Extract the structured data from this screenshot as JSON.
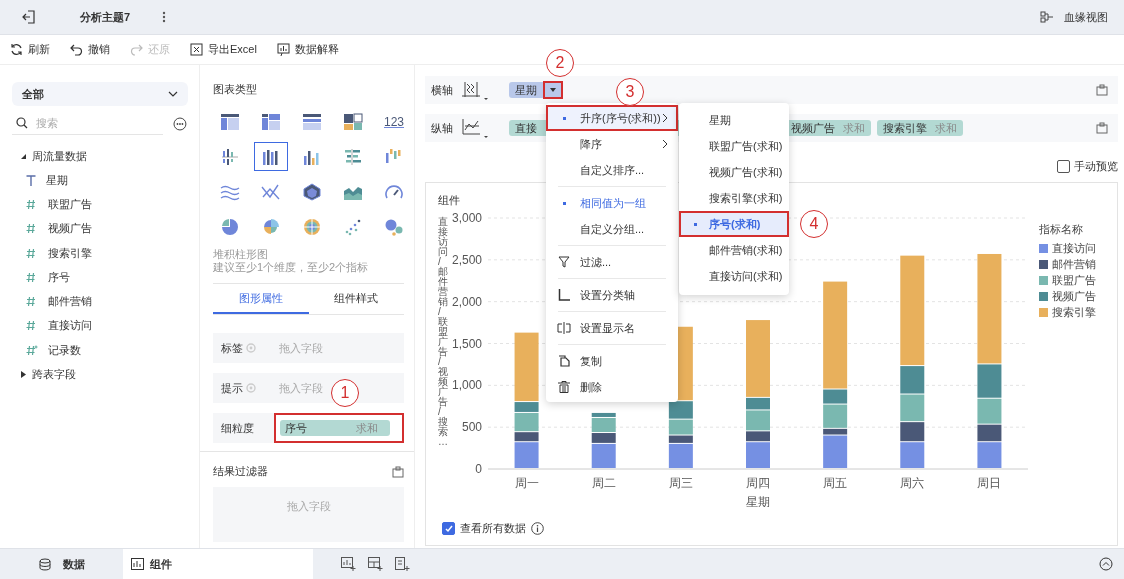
{
  "topbar": {
    "title": "分析主题7",
    "lineage": "血缘视图"
  },
  "toolbar": [
    {
      "label": "刷新",
      "kind": "refresh",
      "disabled": false
    },
    {
      "label": "撤销",
      "kind": "undo",
      "disabled": false
    },
    {
      "label": "还原",
      "kind": "redo",
      "disabled": true
    },
    {
      "label": "导出Excel",
      "kind": "excel",
      "disabled": false
    },
    {
      "label": "数据解释",
      "kind": "explain",
      "disabled": false
    }
  ],
  "fields_panel": {
    "scope": "全部",
    "search_placeholder": "搜索",
    "tree": [
      {
        "label": "周流量数据",
        "expanded": true,
        "children": [
          {
            "label": "星期",
            "kind": "text"
          },
          {
            "label": "联盟广告",
            "kind": "number"
          },
          {
            "label": "视频广告",
            "kind": "number"
          },
          {
            "label": "搜索引擎",
            "kind": "number"
          },
          {
            "label": "序号",
            "kind": "number"
          },
          {
            "label": "邮件营销",
            "kind": "number"
          },
          {
            "label": "直接访问",
            "kind": "number"
          },
          {
            "label": "记录数",
            "kind": "count"
          }
        ]
      },
      {
        "label": "跨表字段",
        "expanded": false
      }
    ]
  },
  "chart_types": {
    "title": "图表类型",
    "items": [
      {
        "kind": "table",
        "selected": false
      },
      {
        "kind": "crosstab",
        "selected": false
      },
      {
        "kind": "grouptable",
        "selected": false
      },
      {
        "kind": "treemap",
        "selected": false
      },
      {
        "kind": "number",
        "label": "123",
        "selected": false
      },
      {
        "kind": "groupbar",
        "selected": false
      },
      {
        "kind": "stackcol",
        "selected": true
      },
      {
        "kind": "column",
        "selected": false
      },
      {
        "kind": "hbar",
        "selected": false
      },
      {
        "kind": "rangecol",
        "selected": false
      },
      {
        "kind": "multiline",
        "selected": false
      },
      {
        "kind": "crossline",
        "selected": false
      },
      {
        "kind": "radar",
        "selected": false
      },
      {
        "kind": "area",
        "selected": false
      },
      {
        "kind": "gauge",
        "selected": false
      },
      {
        "kind": "pie",
        "selected": false
      },
      {
        "kind": "rosepie",
        "selected": false
      },
      {
        "kind": "sunburst",
        "selected": false
      },
      {
        "kind": "scatter",
        "selected": false
      },
      {
        "kind": "bubble",
        "selected": false
      }
    ],
    "name": "堆积柱形图",
    "hint": "建议至少1个维度，至少2个指标"
  },
  "property_tabs": [
    {
      "label": "图形属性",
      "selected": true
    },
    {
      "label": "组件样式",
      "selected": false
    }
  ],
  "properties": [
    {
      "label": "标签",
      "placeholder": "拖入字段",
      "highlighted": false
    },
    {
      "label": "提示",
      "placeholder": "拖入字段",
      "highlighted": false
    },
    {
      "label": "细粒度",
      "pill": {
        "name": "序号",
        "agg": "求和"
      },
      "highlighted": true
    }
  ],
  "result_filter": {
    "title": "结果过滤器",
    "placeholder": "拖入字段"
  },
  "axes": [
    {
      "label": "横轴",
      "kind": "x",
      "pills": [
        {
          "name": "星期",
          "kind": "dimension",
          "dropdown": true,
          "highlighted": true
        }
      ]
    },
    {
      "label": "纵轴",
      "kind": "y",
      "pills": [
        {
          "name": "直接",
          "kind": "measure"
        },
        {
          "name": "视频广告",
          "agg": "求和",
          "kind": "measure"
        },
        {
          "name": "搜索引擎",
          "agg": "求和",
          "kind": "measure"
        }
      ]
    }
  ],
  "manual_preview": {
    "label": "手动预览",
    "checked": false
  },
  "chart_card": {
    "title": "组件",
    "legend_title": "指标名称",
    "show_all": {
      "label": "查看所有数据",
      "checked": true
    },
    "chart_data": {
      "type": "bar",
      "stacked": true,
      "grid": true,
      "xlabel": "星期",
      "ylabel": "直接访问/邮件营销/联盟广告/视频广告/搜索…",
      "categories": [
        "周一",
        "周二",
        "周三",
        "周四",
        "周五",
        "周六",
        "周日"
      ],
      "ylim": [
        0,
        3000
      ],
      "yticks": [
        {
          "value": 0,
          "label": "0"
        },
        {
          "value": 500,
          "label": "500"
        },
        {
          "value": 1000,
          "label": "1,000"
        },
        {
          "value": 1500,
          "label": "1,500"
        },
        {
          "value": 2000,
          "label": "2,000"
        },
        {
          "value": 2500,
          "label": "2,500"
        },
        {
          "value": 3000,
          "label": "3,000"
        }
      ],
      "series": [
        {
          "name": "直接访问",
          "color": "#7590e3",
          "values": [
            320,
            300,
            300,
            320,
            400,
            320,
            320
          ]
        },
        {
          "name": "邮件营销",
          "color": "#4a5877",
          "values": [
            120,
            130,
            100,
            130,
            80,
            240,
            210
          ]
        },
        {
          "name": "联盟广告",
          "color": "#7ab8b0",
          "values": [
            230,
            180,
            190,
            250,
            290,
            330,
            310
          ]
        },
        {
          "name": "视频广告",
          "color": "#4e8c94",
          "values": [
            130,
            60,
            220,
            150,
            180,
            340,
            410
          ]
        },
        {
          "name": "搜索引擎",
          "color": "#e8b05c",
          "values": [
            830,
            null,
            890,
            930,
            1290,
            1320,
            1320
          ]
        }
      ]
    }
  },
  "menu": {
    "items": [
      {
        "kind": "option",
        "label": "升序(序号(求和))",
        "selected": true,
        "submenu": true,
        "highlighted": true
      },
      {
        "kind": "option",
        "label": "降序",
        "selected": false,
        "submenu": true,
        "highlighted": false
      },
      {
        "kind": "option",
        "label": "自定义排序...",
        "selected": false,
        "submenu": false,
        "highlighted": false
      },
      {
        "kind": "divider"
      },
      {
        "kind": "option",
        "label": "相同值为一组",
        "selected": true,
        "submenu": false,
        "highlighted": false
      },
      {
        "kind": "option",
        "label": "自定义分组...",
        "selected": false,
        "submenu": false,
        "highlighted": false
      },
      {
        "kind": "divider"
      },
      {
        "kind": "filter",
        "label": "过滤..."
      },
      {
        "kind": "divider"
      },
      {
        "kind": "axis",
        "label": "设置分类轴"
      },
      {
        "kind": "divider"
      },
      {
        "kind": "rename",
        "label": "设置显示名"
      },
      {
        "kind": "divider"
      },
      {
        "kind": "copy",
        "label": "复制"
      },
      {
        "kind": "delete",
        "label": "删除"
      }
    ]
  },
  "submenu": {
    "items": [
      {
        "label": "星期",
        "selected": false,
        "highlighted": false
      },
      {
        "label": "联盟广告(求和)",
        "selected": false,
        "highlighted": false
      },
      {
        "label": "视频广告(求和)",
        "selected": false,
        "highlighted": false
      },
      {
        "label": "搜索引擎(求和)",
        "selected": false,
        "highlighted": false
      },
      {
        "label": "序号(求和)",
        "selected": true,
        "highlighted": true
      },
      {
        "label": "邮件营销(求和)",
        "selected": false,
        "highlighted": false
      },
      {
        "label": "直接访问(求和)",
        "selected": false,
        "highlighted": false
      }
    ]
  },
  "annotations": [
    "1",
    "2",
    "3",
    "4"
  ],
  "bottom_tabs": [
    {
      "label": "数据",
      "kind": "data",
      "selected": false
    },
    {
      "label": "组件",
      "kind": "widget",
      "selected": true
    }
  ]
}
